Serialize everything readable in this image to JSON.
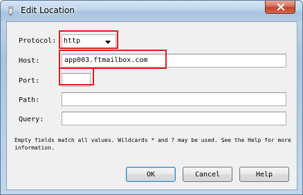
{
  "window": {
    "title": "Edit Location",
    "icon": "pen-icon",
    "close_icon": "close-icon"
  },
  "form": {
    "protocol": {
      "label": "Protocol:",
      "selected": "http"
    },
    "host": {
      "label": "Host:",
      "value": "app003.ftmailbox.com"
    },
    "port": {
      "label": "Port:",
      "value": ""
    },
    "path": {
      "label": "Path:",
      "value": ""
    },
    "query": {
      "label": "Query:",
      "value": ""
    }
  },
  "help_text": "Empty fields match all values. Wildcards * and ? may be used. See the Help for more information.",
  "buttons": {
    "ok": "OK",
    "cancel": "Cancel",
    "help": "Help"
  },
  "colors": {
    "highlight": "#e01b1b",
    "default_button_border": "#3c7fb1"
  }
}
